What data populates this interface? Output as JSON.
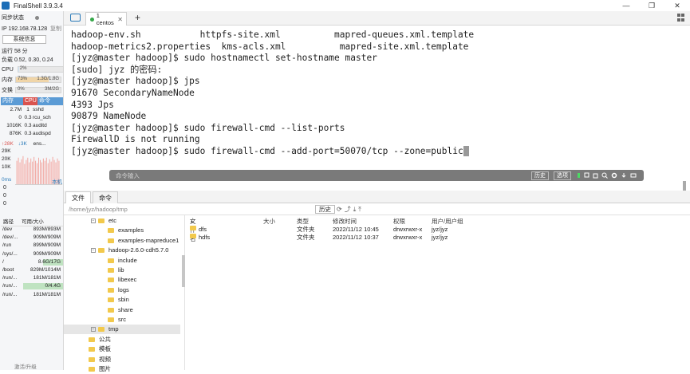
{
  "window": {
    "title": "FinalShell 3.9.3.4",
    "controls": [
      "—",
      "❐",
      "✕"
    ]
  },
  "sidebar": {
    "sync_label": "同步状态",
    "ip_label": "IP 192.168.78.128",
    "copy_label": "复制",
    "sysinfo_button": "系统信息",
    "uptime": "运行 58 分",
    "load": "负载 0.52, 0.30, 0.24",
    "cpu": {
      "label": "CPU",
      "value": "2%",
      "fraction": 0.02
    },
    "mem": {
      "label": "内存",
      "percent": "73%",
      "value": "1.3G/1.8G",
      "fraction": 0.73
    },
    "swap": {
      "label": "交换",
      "percent": "0%",
      "value": "3M/2G",
      "fraction": 0.0
    },
    "proc_headers": [
      "内存",
      "CPU",
      "命令"
    ],
    "processes": [
      {
        "mem": "2.7M",
        "cpu": "1",
        "cmd": "sshd"
      },
      {
        "mem": "0",
        "cpu": "0.3",
        "cmd": "rcu_sch"
      },
      {
        "mem": "1016K",
        "cpu": "0.3",
        "cmd": "auditd"
      },
      {
        "mem": "876K",
        "cpu": "0.3",
        "cmd": "audispd"
      }
    ],
    "net": {
      "up": "↑28K",
      "down": "↓3K",
      "iface": "ens..."
    },
    "net_scale": [
      "29K",
      "20K",
      "10K"
    ],
    "latency": {
      "label": "0ms",
      "host": "本机",
      "values": [
        "0",
        "0",
        "0"
      ]
    },
    "disk_headers": [
      "路径",
      "可用/大小"
    ],
    "disks": [
      {
        "path": "/dev",
        "value": "893M/893M",
        "fraction": 0.0
      },
      {
        "path": "/dev/...",
        "value": "909M/909M",
        "fraction": 0.0
      },
      {
        "path": "/run",
        "value": "899M/909M",
        "fraction": 0.0
      },
      {
        "path": "/sys/...",
        "value": "909M/909M",
        "fraction": 0.0
      },
      {
        "path": "/",
        "value": "8.6G/17G",
        "fraction": 0.5
      },
      {
        "path": "/boot",
        "value": "829M/1014M",
        "fraction": 0.0
      },
      {
        "path": "/run/...",
        "value": "181M/181M",
        "fraction": 0.0
      },
      {
        "path": "/run/...",
        "value": "0/4.4G",
        "fraction": 1.0
      },
      {
        "path": "/run/...",
        "value": "181M/181M",
        "fraction": 0.0
      }
    ],
    "activate": "激活/升级"
  },
  "tabs": [
    {
      "label": "1 centos",
      "close": "✕"
    }
  ],
  "add_tab": "+",
  "terminal": {
    "lines": [
      "hadoop-env.sh           httpfs-site.xml          mapred-queues.xml.template",
      "hadoop-metrics2.properties  kms-acls.xml          mapred-site.xml.template",
      "[jyz@master hadoop]$ sudo hostnamectl set-hostname master",
      "[sudo] jyz 的密码:",
      "[jyz@master hadoop]$ jps",
      "91670 SecondaryNameNode",
      "4393 Jps",
      "90879 NameNode",
      "[jyz@master hadoop]$ sudo firewall-cmd --list-ports",
      "FirewallD is not running",
      "[jyz@master hadoop]$ sudo firewall-cmd --add-port=50070/tcp --zone=public"
    ]
  },
  "command_bar": {
    "placeholder": "命令输入",
    "history": "历史",
    "options": "选项"
  },
  "lower_tabs": [
    "文件",
    "命令"
  ],
  "path": {
    "value": "/home/jyz/hadoop/tmp",
    "history": "历史"
  },
  "tree": [
    {
      "label": "etc",
      "indent": 2,
      "expander": true
    },
    {
      "label": "examples",
      "indent": 3
    },
    {
      "label": "examples-mapreduce1",
      "indent": 3
    },
    {
      "label": "hadoop-2.6.0-cdh5.7.0",
      "indent": 2,
      "expander": true
    },
    {
      "label": "include",
      "indent": 3
    },
    {
      "label": "lib",
      "indent": 3
    },
    {
      "label": "libexec",
      "indent": 3
    },
    {
      "label": "logs",
      "indent": 3
    },
    {
      "label": "sbin",
      "indent": 3
    },
    {
      "label": "share",
      "indent": 3
    },
    {
      "label": "src",
      "indent": 3
    },
    {
      "label": "tmp",
      "indent": 2,
      "expander": true,
      "selected": true
    },
    {
      "label": "公共",
      "indent": 1
    },
    {
      "label": "模板",
      "indent": 1
    },
    {
      "label": "视频",
      "indent": 1
    },
    {
      "label": "图片",
      "indent": 1
    }
  ],
  "file_list": {
    "headers": {
      "name": "文件名",
      "sort": "▲",
      "size": "大小",
      "type": "类型",
      "mtime": "修改时间",
      "perm": "权限",
      "owner": "用户/用户组"
    },
    "rows": [
      {
        "name": "dfs",
        "size": "",
        "type": "文件夹",
        "mtime": "2022/11/12 10:45",
        "perm": "drwxrwxr-x",
        "owner": "jyz/jyz"
      },
      {
        "name": "hdfs",
        "size": "",
        "type": "文件夹",
        "mtime": "2022/11/12 10:37",
        "perm": "drwxrwxr-x",
        "owner": "jyz/jyz"
      }
    ]
  },
  "colors": {
    "accent": "#2a7ab8",
    "cpu_bar": "#cfe6f7",
    "mem_bar": "#f0d5a8",
    "folder": "#f2c94c",
    "net_graph": "#f2a6a0"
  }
}
